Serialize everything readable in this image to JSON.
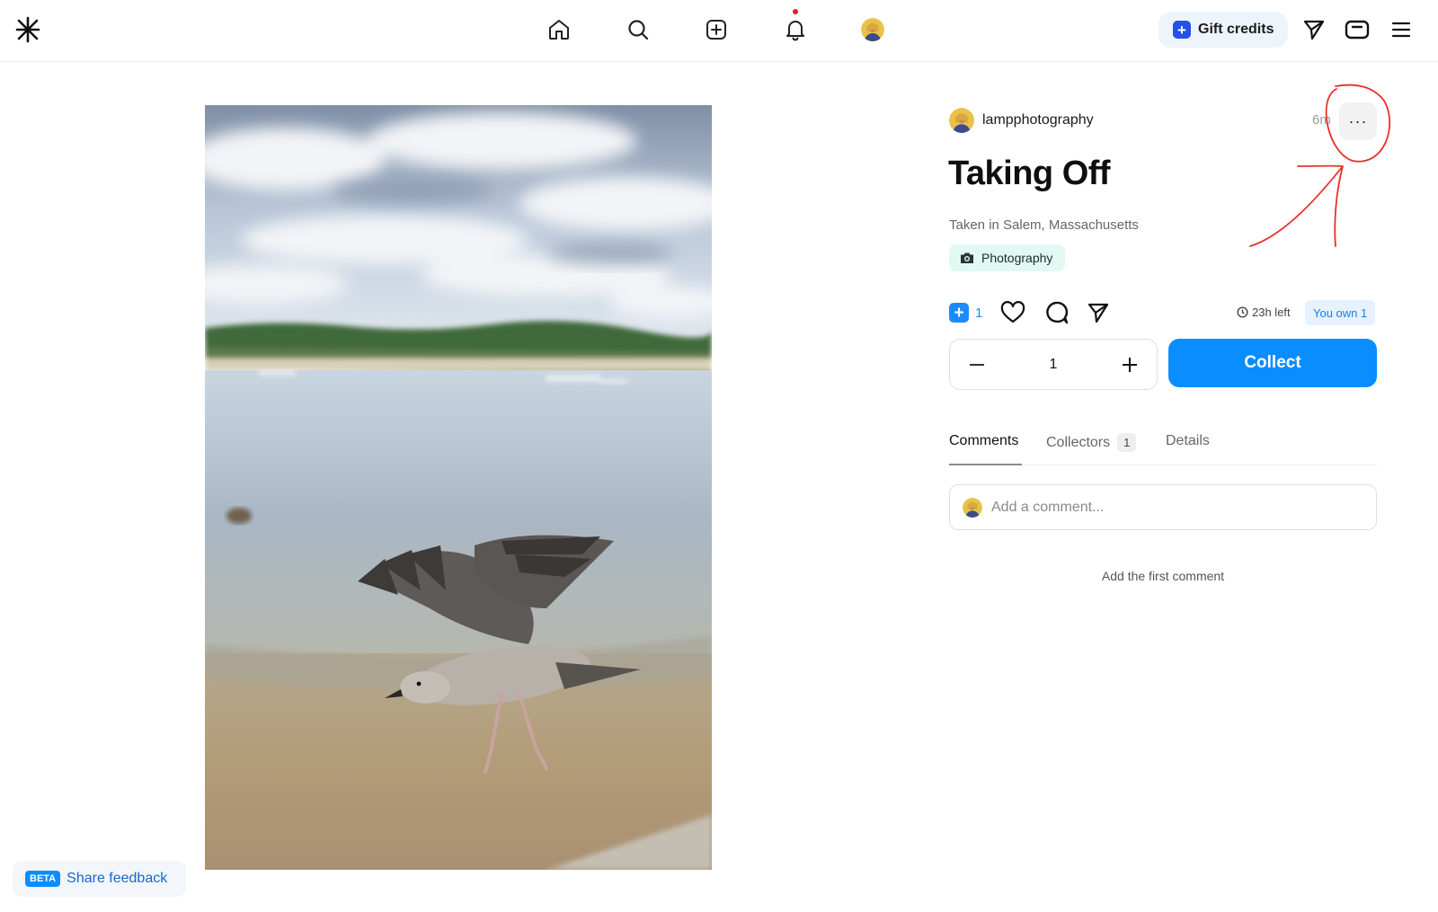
{
  "header": {
    "nav": [
      {
        "icon": "home-icon"
      },
      {
        "icon": "search-icon"
      },
      {
        "icon": "create-icon"
      },
      {
        "icon": "bell-icon",
        "has_notification": true
      },
      {
        "icon": "avatar"
      }
    ],
    "gift_credits_label": "Gift credits",
    "accent_color": "#2651e8"
  },
  "post": {
    "author": "lampphotography",
    "time": "6m",
    "title": "Taking Off",
    "description": "Taken in Salem, Massachusetts",
    "tag": "Photography",
    "plus_count": "1",
    "time_left": "23h left",
    "own_badge": "You own 1",
    "quantity": "1",
    "collect_label": "Collect",
    "collect_color": "#0a8dff"
  },
  "tabs": [
    {
      "label": "Comments",
      "active": true
    },
    {
      "label": "Collectors",
      "badge": "1"
    },
    {
      "label": "Details"
    }
  ],
  "comments": {
    "placeholder": "Add a comment...",
    "empty_text": "Add the first comment"
  },
  "feedback": {
    "badge": "BETA",
    "label": "Share feedback"
  },
  "annotation": {
    "color": "#e8312a"
  }
}
